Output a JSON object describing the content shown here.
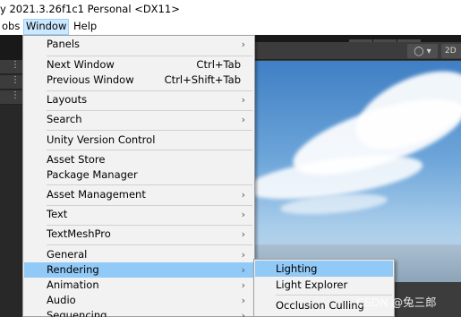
{
  "title_bar": {
    "text": "y 2021.3.26f1c1 Personal <DX11>"
  },
  "menubar": {
    "items": [
      {
        "label": "obs",
        "active": false
      },
      {
        "label": "Window",
        "active": true
      },
      {
        "label": "Help",
        "active": false
      }
    ]
  },
  "toolbar": {
    "play_icon": "▶",
    "pause_icon": "❚❚",
    "step_icon": "▶|"
  },
  "scene_view": {
    "gizmo_icon": "◯ ▾",
    "mode_2d_label": "2D"
  },
  "left_panel": {
    "icons": [
      "⋮",
      "⋮",
      "⋮"
    ]
  },
  "window_menu": {
    "items": [
      {
        "label": "Panels",
        "shortcut": "",
        "submenu": true,
        "selected": false
      },
      {
        "label": "Next Window",
        "shortcut": "Ctrl+Tab",
        "submenu": false,
        "selected": false
      },
      {
        "label": "Previous Window",
        "shortcut": "Ctrl+Shift+Tab",
        "submenu": false,
        "selected": false
      },
      {
        "label": "Layouts",
        "shortcut": "",
        "submenu": true,
        "selected": false
      },
      {
        "label": "Search",
        "shortcut": "",
        "submenu": true,
        "selected": false
      },
      {
        "label": "Unity Version Control",
        "shortcut": "",
        "submenu": false,
        "selected": false
      },
      {
        "label": "Asset Store",
        "shortcut": "",
        "submenu": false,
        "selected": false
      },
      {
        "label": "Package Manager",
        "shortcut": "",
        "submenu": false,
        "selected": false
      },
      {
        "label": "Asset Management",
        "shortcut": "",
        "submenu": true,
        "selected": false
      },
      {
        "label": "Text",
        "shortcut": "",
        "submenu": true,
        "selected": false
      },
      {
        "label": "TextMeshPro",
        "shortcut": "",
        "submenu": true,
        "selected": false
      },
      {
        "label": "General",
        "shortcut": "",
        "submenu": true,
        "selected": false
      },
      {
        "label": "Rendering",
        "shortcut": "",
        "submenu": true,
        "selected": true
      },
      {
        "label": "Animation",
        "shortcut": "",
        "submenu": true,
        "selected": false
      },
      {
        "label": "Audio",
        "shortcut": "",
        "submenu": true,
        "selected": false
      },
      {
        "label": "Sequencing",
        "shortcut": "",
        "submenu": true,
        "selected": false
      }
    ]
  },
  "rendering_submenu": {
    "items": [
      {
        "label": "Lighting",
        "selected": true
      },
      {
        "label": "Light Explorer",
        "selected": false
      },
      {
        "label": "Occlusion Culling",
        "selected": false
      }
    ]
  },
  "watermark": {
    "text": "CSDN @兔三郎"
  },
  "colors": {
    "menu_highlight": "#91c9f7",
    "menubar_active": "#cce8ff",
    "editor_dark": "#191919"
  }
}
